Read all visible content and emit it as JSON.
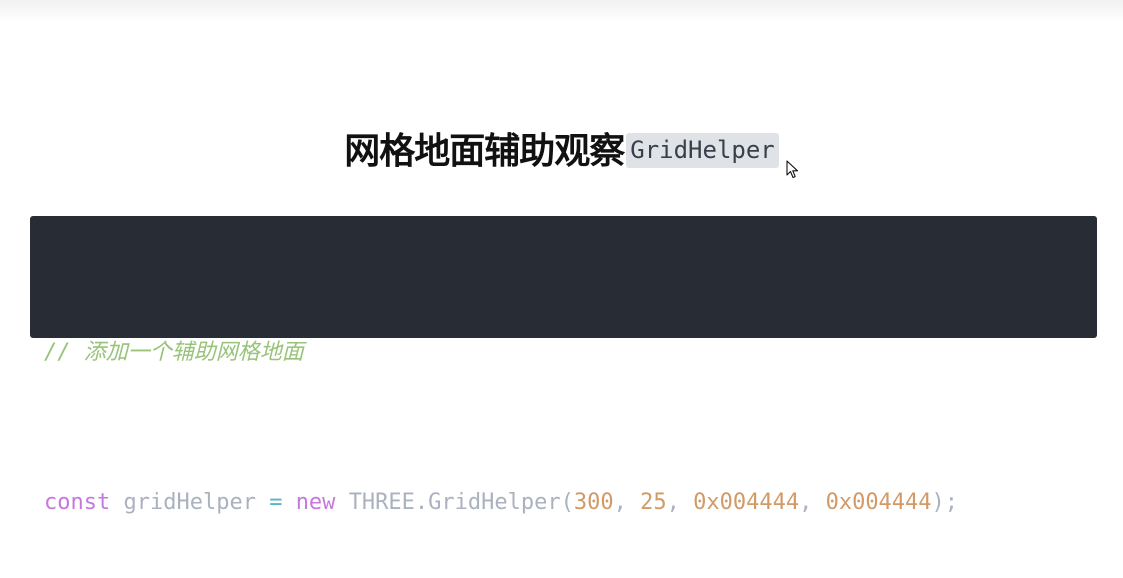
{
  "heading": {
    "title": "网格地面辅助观察",
    "inline_code": "GridHelper"
  },
  "code_block": {
    "comment": "// 添加一个辅助网格地面",
    "line2": {
      "kw_const": "const",
      "var_name": "gridHelper",
      "op_assign": "=",
      "kw_new": "new",
      "class_name": "THREE.GridHelper(",
      "arg1": "300",
      "sep1": ", ",
      "arg2": "25",
      "sep2": ", ",
      "arg3": "0x004444",
      "sep3": ", ",
      "arg4": "0x004444",
      "close": ");"
    }
  },
  "colors": {
    "code_background": "#282c34",
    "comment": "#98c379",
    "keyword": "#c678dd",
    "number": "#d19a66",
    "inline_code_background": "#dfe3e8"
  },
  "icons": {
    "cursor": "mouse-pointer-icon"
  }
}
